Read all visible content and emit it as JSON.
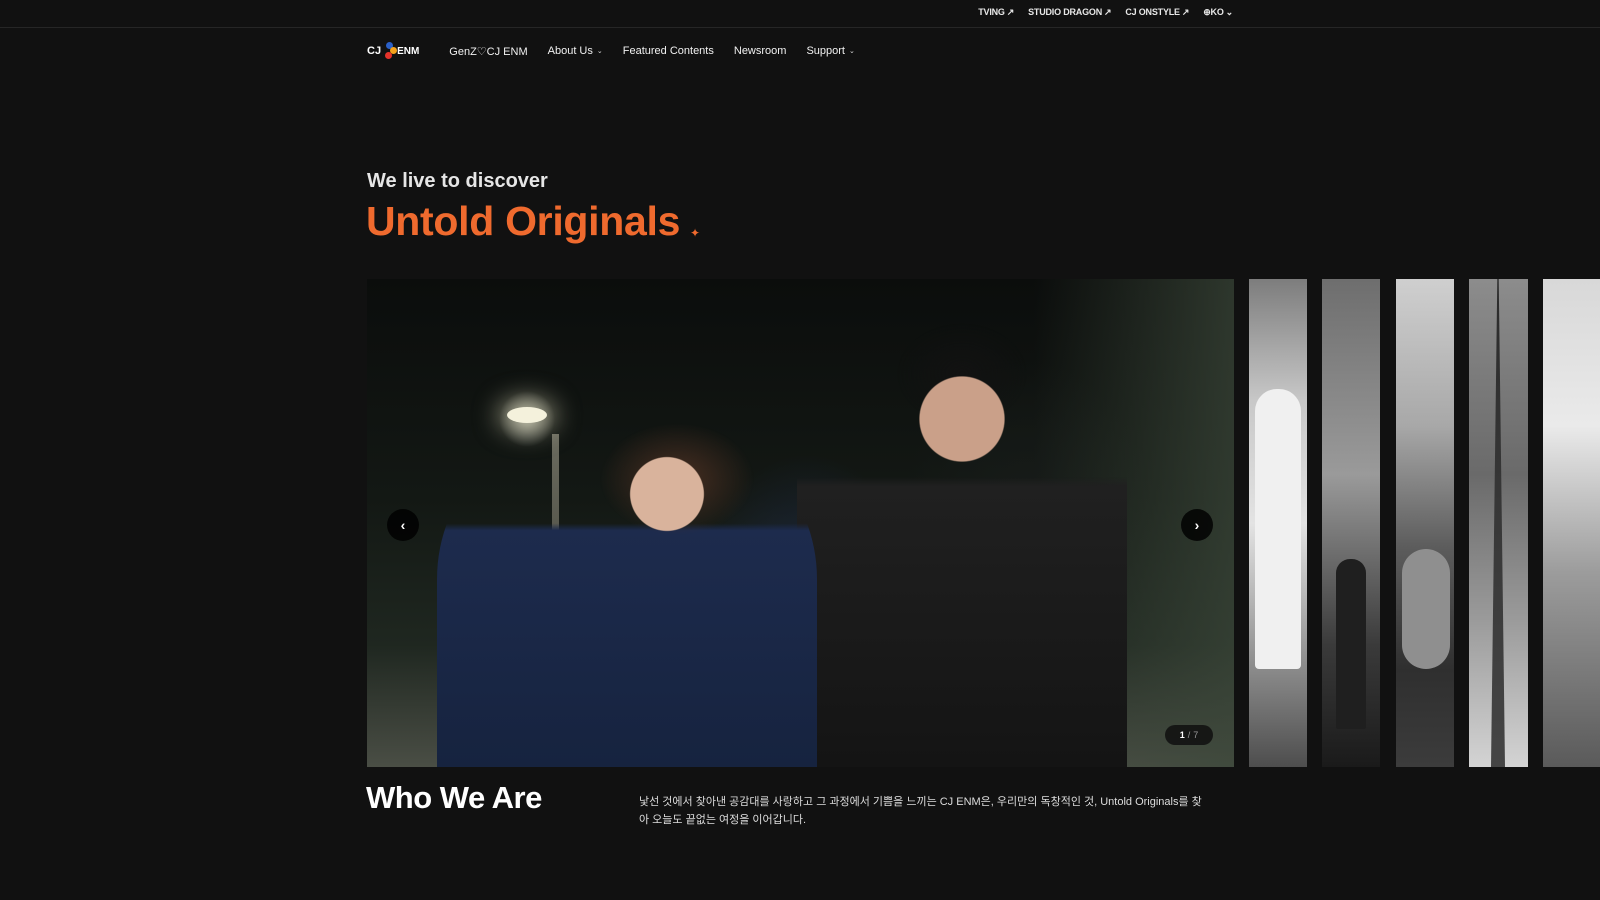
{
  "utility": {
    "links": [
      {
        "label": "TVING",
        "external": true
      },
      {
        "label": "STUDIO DRAGON",
        "external": true
      },
      {
        "label": "CJ ONSTYLE",
        "external": true
      }
    ],
    "language": "KO",
    "external_glyph": "↗",
    "chevron_glyph": "⌄",
    "globe_glyph": "⊕"
  },
  "brand": {
    "cj": "CJ",
    "enm": "ENM",
    "mark_colors": [
      "#2a5fc7",
      "#f4a21c",
      "#e4332b"
    ]
  },
  "nav": {
    "items": [
      {
        "label": "GenZ♡CJ ENM",
        "dropdown": false
      },
      {
        "label": "About Us",
        "dropdown": true
      },
      {
        "label": "Featured Contents",
        "dropdown": false
      },
      {
        "label": "Newsroom",
        "dropdown": false
      },
      {
        "label": "Support",
        "dropdown": true
      }
    ]
  },
  "hero": {
    "kicker": "We live to discover",
    "title": "Untold Originals",
    "spark": "✦",
    "accent": "#ef6a2e"
  },
  "carousel": {
    "current": "1",
    "separator": "/",
    "total": "7",
    "prev_glyph": "‹",
    "next_glyph": "›"
  },
  "who": {
    "title": "Who We Are",
    "description": "낯선 것에서 찾아낸 공감대를 사랑하고 그 과정에서 기쁨을 느끼는 CJ ENM은, 우리만의 독창적인 것, Untold Originals를 찾아 오늘도 끝없는 여정을 이어갑니다."
  }
}
